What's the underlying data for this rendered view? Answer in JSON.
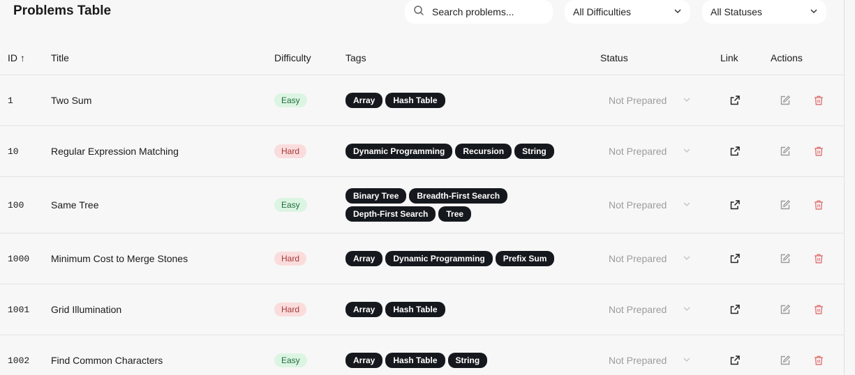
{
  "header": {
    "title": "Problems Table",
    "search_placeholder": "Search problems...",
    "difficulty_filter": "All Difficulties",
    "status_filter": "All Statuses"
  },
  "columns": {
    "id": "ID ↑",
    "title": "Title",
    "difficulty": "Difficulty",
    "tags": "Tags",
    "status": "Status",
    "link": "Link",
    "actions": "Actions"
  },
  "rows": [
    {
      "id": "1",
      "title": "Two Sum",
      "difficulty": "Easy",
      "tags": [
        "Array",
        "Hash Table"
      ],
      "status": "Not Prepared"
    },
    {
      "id": "10",
      "title": "Regular Expression Matching",
      "difficulty": "Hard",
      "tags": [
        "Dynamic Programming",
        "Recursion",
        "String"
      ],
      "status": "Not Prepared"
    },
    {
      "id": "100",
      "title": "Same Tree",
      "difficulty": "Easy",
      "tags": [
        "Binary Tree",
        "Breadth-First Search",
        "Depth-First Search",
        "Tree"
      ],
      "status": "Not Prepared"
    },
    {
      "id": "1000",
      "title": "Minimum Cost to Merge Stones",
      "difficulty": "Hard",
      "tags": [
        "Array",
        "Dynamic Programming",
        "Prefix Sum"
      ],
      "status": "Not Prepared"
    },
    {
      "id": "1001",
      "title": "Grid Illumination",
      "difficulty": "Hard",
      "tags": [
        "Array",
        "Hash Table"
      ],
      "status": "Not Prepared"
    },
    {
      "id": "1002",
      "title": "Find Common Characters",
      "difficulty": "Easy",
      "tags": [
        "Array",
        "Hash Table",
        "String"
      ],
      "status": "Not Prepared"
    }
  ],
  "colors": {
    "easy_bg": "#dcf5e3",
    "hard_bg": "#fbdcdc",
    "tag_bg": "#15181d",
    "delete_icon": "#e07575"
  },
  "icons": {
    "search": "search-icon",
    "dropdown": "chevron-down-icon",
    "link": "external-link-icon",
    "edit": "edit-icon",
    "delete": "trash-icon"
  }
}
